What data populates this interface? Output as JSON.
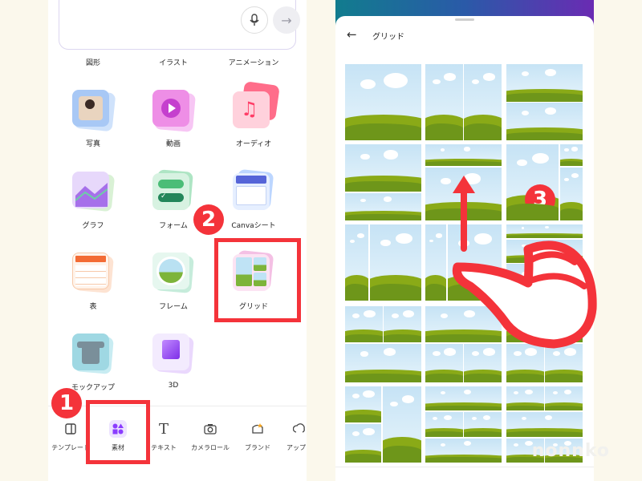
{
  "left": {
    "row1_labels": [
      "図形",
      "イラスト",
      "アニメーション"
    ],
    "items": [
      {
        "label": "写真"
      },
      {
        "label": "動画"
      },
      {
        "label": "オーディオ"
      },
      {
        "label": "グラフ"
      },
      {
        "label": "フォーム"
      },
      {
        "label": "Canvaシート"
      },
      {
        "label": "表"
      },
      {
        "label": "フレーム"
      },
      {
        "label": "グリッド"
      },
      {
        "label": "モックアップ"
      },
      {
        "label": "3D"
      }
    ],
    "nav": [
      {
        "label": "テンプレート",
        "icon": "template-icon"
      },
      {
        "label": "素材",
        "icon": "elements-icon"
      },
      {
        "label": "テキスト",
        "icon": "text-icon"
      },
      {
        "label": "カメラロール",
        "icon": "camera-icon"
      },
      {
        "label": "ブランド",
        "icon": "brand-icon"
      },
      {
        "label": "アップロ",
        "icon": "upload-icon"
      }
    ],
    "text_glyph": "T",
    "send_glyph": "→"
  },
  "badges": {
    "one": "1",
    "two": "2",
    "three": "3"
  },
  "right": {
    "back_glyph": "←",
    "title": "グリッド"
  },
  "watermark": "nonnko",
  "colors": {
    "callout": "#f4333a",
    "accent": "#8b3dff",
    "gradient_start": "#117c8e",
    "gradient_end": "#6a2bb3"
  }
}
